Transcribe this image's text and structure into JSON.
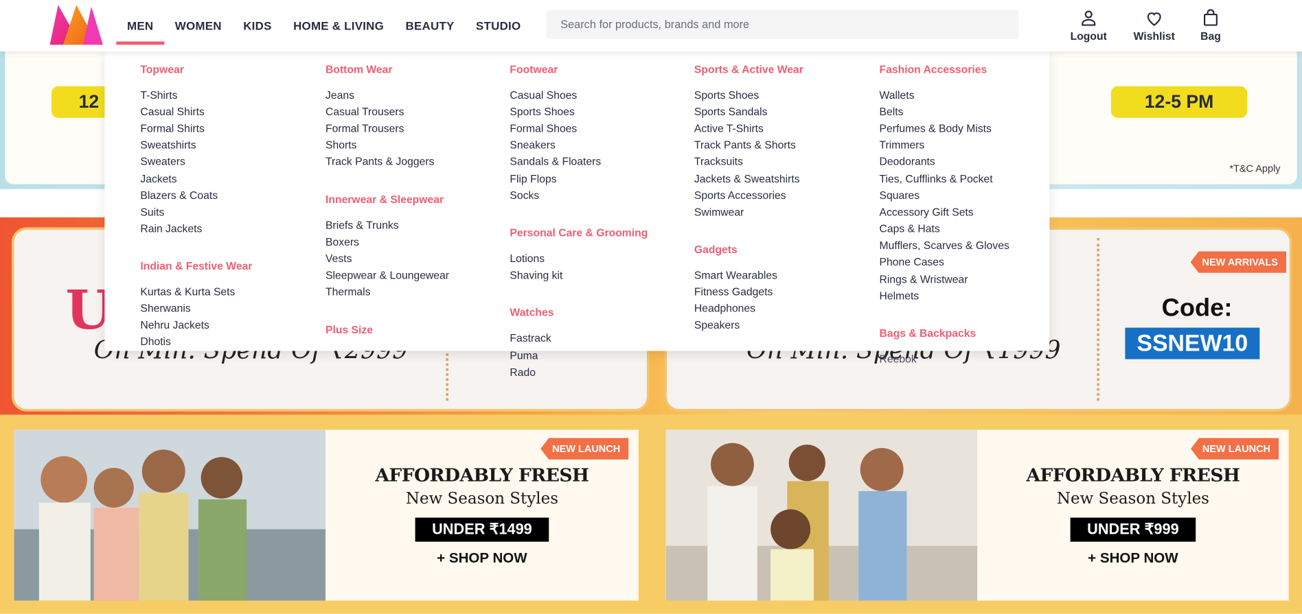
{
  "header": {
    "nav": [
      "MEN",
      "WOMEN",
      "KIDS",
      "HOME & LIVING",
      "BEAUTY",
      "STUDIO"
    ],
    "search_placeholder": "Search for products, brands and more",
    "actions": {
      "logout": "Logout",
      "wishlist": "Wishlist",
      "bag": "Bag"
    }
  },
  "menu": {
    "col1": {
      "g1": {
        "title": "Topwear",
        "items": [
          "T-Shirts",
          "Casual Shirts",
          "Formal Shirts",
          "Sweatshirts",
          "Sweaters",
          "Jackets",
          "Blazers & Coats",
          "Suits",
          "Rain Jackets"
        ]
      },
      "g2": {
        "title": "Indian & Festive Wear",
        "items": [
          "Kurtas & Kurta Sets",
          "Sherwanis",
          "Nehru Jackets",
          "Dhotis"
        ]
      }
    },
    "col2": {
      "g1": {
        "title": "Bottom Wear",
        "items": [
          "Jeans",
          "Casual Trousers",
          "Formal Trousers",
          "Shorts",
          "Track Pants & Joggers"
        ]
      },
      "g2": {
        "title": "Innerwear & Sleepwear",
        "items": [
          "Briefs & Trunks",
          "Boxers",
          "Vests",
          "Sleepwear & Loungewear",
          "Thermals"
        ]
      },
      "g3": {
        "title": "Plus Size"
      }
    },
    "col3": {
      "g1": {
        "title": "Footwear",
        "items": [
          "Casual Shoes",
          "Sports Shoes",
          "Formal Shoes",
          "Sneakers",
          "Sandals & Floaters",
          "Flip Flops",
          "Socks"
        ]
      },
      "g2": {
        "title": "Personal Care & Grooming",
        "items": [
          "Lotions",
          "Shaving kit"
        ]
      },
      "g3": {
        "title": "Watches",
        "items": [
          "Fastrack",
          "Puma",
          "Rado"
        ]
      }
    },
    "col4": {
      "g1": {
        "title": "Sports & Active Wear",
        "items": [
          "Sports Shoes",
          "Sports Sandals",
          "Active T-Shirts",
          "Track Pants & Shorts",
          "Tracksuits",
          "Jackets & Sweatshirts",
          "Sports Accessories",
          "Swimwear"
        ]
      },
      "g2": {
        "title": "Gadgets",
        "items": [
          "Smart Wearables",
          "Fitness Gadgets",
          "Headphones",
          "Speakers"
        ]
      }
    },
    "col5": {
      "g1": {
        "title": "Fashion Accessories",
        "items": [
          "Wallets",
          "Belts",
          "Perfumes & Body Mists",
          "Trimmers",
          "Deodorants",
          "Ties, Cufflinks & Pocket",
          "Squares",
          "Accessory Gift Sets",
          "Caps & Hats",
          "Mufflers, Scarves & Gloves",
          "Phone Cases",
          "Rings & Wristwear",
          "Helmets"
        ]
      },
      "g2": {
        "title": "Bags & Backpacks",
        "items": [
          "Reebok"
        ]
      }
    }
  },
  "banners": {
    "time_left": "12",
    "time_right": "12-5 PM",
    "tc": "*T&C Apply",
    "offer_left_partial": "U",
    "offer_left_sub": "On Min. Spend Of ₹2999",
    "offer_right_sub": "On Min. Spend Of ₹1999",
    "new_arrivals": "NEW ARRIVALS",
    "code_label": "Code:",
    "code_value": "SSNEW10",
    "promo_left": {
      "tag": "NEW LAUNCH",
      "title": "AFFORDABLY FRESH",
      "subtitle": "New Season Styles",
      "price": "UNDER ₹1499",
      "cta": "+ SHOP NOW"
    },
    "promo_right": {
      "tag": "NEW LAUNCH",
      "title": "AFFORDABLY FRESH",
      "subtitle": "New Season Styles",
      "price": "UNDER ₹999",
      "cta": "+ SHOP NOW"
    }
  },
  "colors": {
    "accent": "#ee5f73",
    "text": "#282c3f",
    "code_bg": "#1670c6",
    "tag_bg": "#f36f46"
  }
}
